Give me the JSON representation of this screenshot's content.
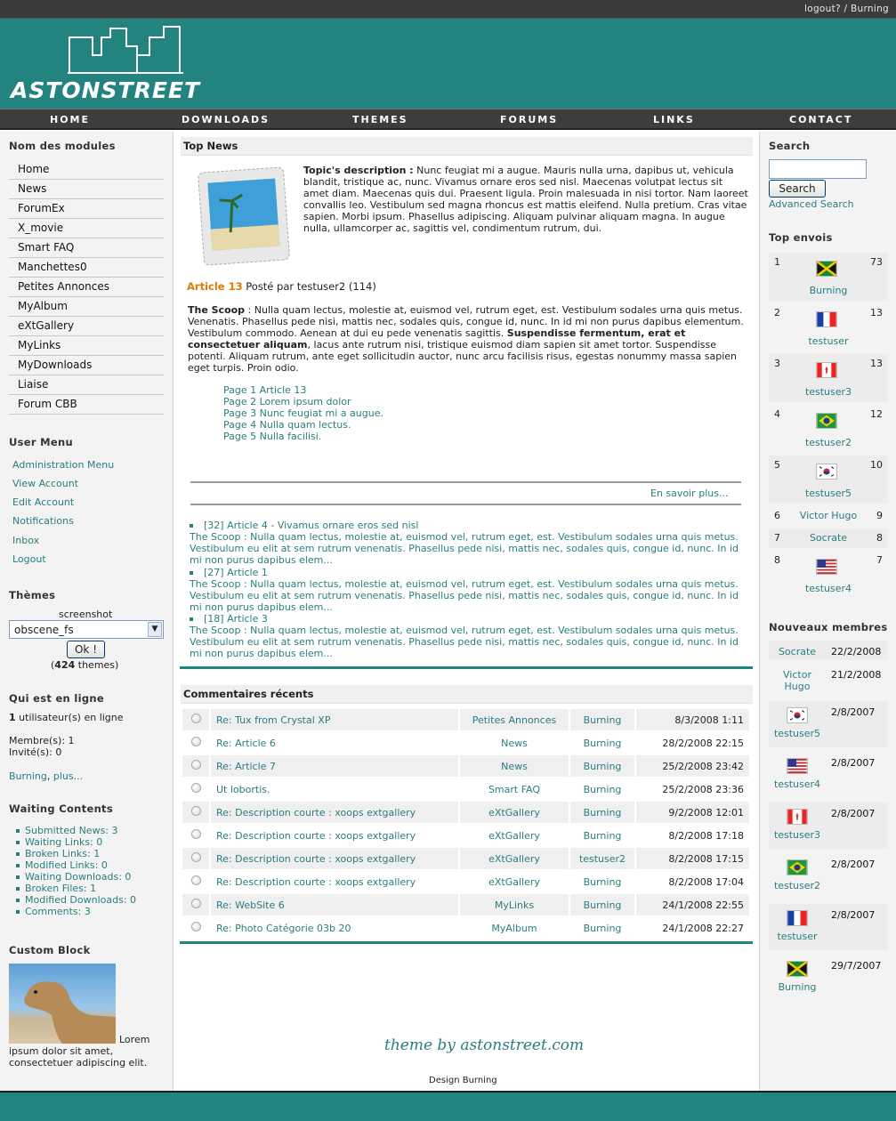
{
  "topbar": {
    "logout": "logout?",
    "sep": "/",
    "user": "Burning"
  },
  "logo": {
    "text": "ASTONSTREET"
  },
  "nav": [
    "HOME",
    "DOWNLOADS",
    "THEMES",
    "FORUMS",
    "LINKS",
    "CONTACT"
  ],
  "left": {
    "modules_title": "Nom des modules",
    "modules": [
      "Home",
      "News",
      "ForumEx",
      "X_movie",
      "Smart FAQ",
      "Manchettes0",
      "Petites Annonces",
      "MyAlbum",
      "eXtGallery",
      "MyLinks",
      "MyDownloads",
      "Liaise",
      "Forum CBB"
    ],
    "usermenu_title": "User Menu",
    "usermenu": [
      "Administration Menu",
      "View Account",
      "Edit Account",
      "Notifications",
      "Inbox",
      "Logout"
    ],
    "themes_title": "Thèmes",
    "themes_screenshot": "screenshot",
    "themes_selected": "obscene_fs",
    "themes_ok": "Ok !",
    "themes_count": "424",
    "themes_count_suffix": " themes)",
    "themes_count_prefix": "(",
    "online_title": "Qui est en ligne",
    "online_count": "1",
    "online_text": " utilisateur(s) en ligne",
    "members": "Membre(s): 1",
    "guests": "Invité(s): 0",
    "online_user": "Burning",
    "online_more": "plus...",
    "waiting_title": "Waiting Contents",
    "waiting": [
      "Submitted News: 3",
      "Waiting Links: 0",
      "Broken Links: 1",
      "Modified Links: 0",
      "Waiting Downloads: 0",
      "Broken Files: 1",
      "Modified Downloads: 0",
      "Comments: 3"
    ],
    "custom_title": "Custom Block",
    "custom_text": "Lorem ipsum dolor sit amet, consectetuer adipiscing elit."
  },
  "main": {
    "topnews_title": "Top News",
    "topic_label": "Topic's description :",
    "topic_text": " Nunc feugiat mi a augue. Mauris nulla urna, dapibus ut, vehicula blandit, tristique ac, nunc. Vivamus ornare eros sed nisl. Maecenas volutpat lectus sit amet diam. Maecenas quis dui. Praesent ligula. Proin malesuada in nisi tortor. Nam laoreet convallis leo. Vestibulum sed magna rhoncus est mattis eleifend. Nulla pretium. Cras vitae sapien. Morbi ipsum. Phasellus adipiscing. Aliquam pulvinar aliquam magna. In augue nulla, ullamcorper ac, sagittis vel, condimentum rutrum, dui.",
    "article_title": "Article 13",
    "article_by": " Posté par testuser2 (114)",
    "scoop_label": "The Scoop",
    "scoop_text1": " : Nulla quam lectus, molestie at, euismod vel, rutrum eget, est. Vestibulum sodales urna quis metus. Venenatis. Phasellus pede nisi, mattis nec, sodales quis, congue id, nunc. In id mi non purus dapibus elementum. Vestibulum commodo. Aenean at dui eu pede venenatis sagittis. ",
    "scoop_bold": "Suspendisse fermentum, erat et consectetuer aliquam",
    "scoop_text2": ", lacus ante rutrum nisi, tristique euismod diam sapien sit amet tortor. Suspendisse potenti. Aliquam rutrum, ante eget sollicitudin auctor, nunc arcu facilisis risus, egestas nonummy massa sapien eget turpis. Proin odio.",
    "pages": [
      "Page 1 Article 13",
      "Page 2 Lorem ipsum dolor",
      "Page 3 Nunc feugiat mi a augue.",
      "Page 4 Nulla quam lectus.",
      "Page 5 Nulla facilisi."
    ],
    "more": "En savoir plus...",
    "articles": [
      {
        "id": "[32]",
        "title": "Article 4 - Vivamus ornare eros sed nisl",
        "text": "The Scoop : Nulla quam lectus, molestie at, euismod vel, rutrum eget, est. Vestibulum sodales urna quis metus. Vestibulum eu elit at sem rutrum venenatis. Phasellus pede nisi, mattis nec, sodales quis, congue id, nunc. In id mi non purus dapibus elem..."
      },
      {
        "id": "[27]",
        "title": "Article 1",
        "text": "The Scoop : Nulla quam lectus, molestie at, euismod vel, rutrum eget, est. Vestibulum sodales urna quis metus. Vestibulum eu elit at sem rutrum venenatis. Phasellus pede nisi, mattis nec, sodales quis, congue id, nunc. In id mi non purus dapibus elem..."
      },
      {
        "id": "[18]",
        "title": "Article 3",
        "text": "The Scoop : Nulla quam lectus, molestie at, euismod vel, rutrum eget, est. Vestibulum sodales urna quis metus. Vestibulum eu elit at sem rutrum venenatis. Phasellus pede nisi, mattis nec, sodales quis, congue id, nunc. In id mi non purus dapibus elem..."
      }
    ],
    "comments_title": "Commentaires récents",
    "comments": [
      {
        "title": "Re: Tux from Crystal XP",
        "module": "Petites Annonces",
        "user": "Burning",
        "date": "8/3/2008 1:11",
        "icon": "circle-icon"
      },
      {
        "title": "Re: Article 6",
        "module": "News",
        "user": "Burning",
        "date": "28/2/2008 22:15",
        "icon": "circle-icon"
      },
      {
        "title": "Re: Article 7",
        "module": "News",
        "user": "Burning",
        "date": "25/2/2008 23:42",
        "icon": "circle-icon"
      },
      {
        "title": "Ut lobortis.",
        "module": "Smart FAQ",
        "user": "Burning",
        "date": "25/2/2008 23:36",
        "icon": "circle-icon"
      },
      {
        "title": "Re: Description courte : xoops extgallery",
        "module": "eXtGallery",
        "user": "Burning",
        "date": "9/2/2008 12:01",
        "icon": "smiley-icon"
      },
      {
        "title": "Re: Description courte : xoops extgallery",
        "module": "eXtGallery",
        "user": "Burning",
        "date": "8/2/2008 17:18",
        "icon": "circle-icon"
      },
      {
        "title": "Re: Description courte : xoops extgallery",
        "module": "eXtGallery",
        "user": "testuser2",
        "date": "8/2/2008 17:15",
        "icon": "circle-icon"
      },
      {
        "title": "Re: Description courte : xoops extgallery",
        "module": "eXtGallery",
        "user": "Burning",
        "date": "8/2/2008 17:04",
        "icon": "circle-icon"
      },
      {
        "title": "Re: WebSite 6",
        "module": "MyLinks",
        "user": "Burning",
        "date": "24/1/2008 22:55",
        "icon": "circle-icon"
      },
      {
        "title": "Re: Photo Catégorie 03b 20",
        "module": "MyAlbum",
        "user": "Burning",
        "date": "24/1/2008 22:27",
        "icon": "circle-icon"
      }
    ],
    "footer_sig": "theme by astonstreet.com",
    "footer_design": "Design Burning"
  },
  "right": {
    "search_title": "Search",
    "search_value": "",
    "search_button": "Search",
    "advanced": "Advanced Search",
    "top_title": "Top envois",
    "top": [
      {
        "rank": "1",
        "user": "Burning",
        "count": "73",
        "flag": "jamaica"
      },
      {
        "rank": "2",
        "user": "testuser",
        "count": "13",
        "flag": "france"
      },
      {
        "rank": "3",
        "user": "testuser3",
        "count": "13",
        "flag": "canada"
      },
      {
        "rank": "4",
        "user": "testuser2",
        "count": "12",
        "flag": "brazil"
      },
      {
        "rank": "5",
        "user": "testuser5",
        "count": "10",
        "flag": "korea"
      },
      {
        "rank": "6",
        "user": "Victor Hugo",
        "count": "9",
        "flag": ""
      },
      {
        "rank": "7",
        "user": "Socrate",
        "count": "8",
        "flag": ""
      },
      {
        "rank": "8",
        "user": "testuser4",
        "count": "7",
        "flag": "usa"
      }
    ],
    "new_title": "Nouveaux membres",
    "new": [
      {
        "user": "Socrate",
        "date": "22/2/2008",
        "flag": ""
      },
      {
        "user": "Victor Hugo",
        "date": "21/2/2008",
        "flag": ""
      },
      {
        "user": "testuser5",
        "date": "2/8/2007",
        "flag": "korea"
      },
      {
        "user": "testuser4",
        "date": "2/8/2007",
        "flag": "usa"
      },
      {
        "user": "testuser3",
        "date": "2/8/2007",
        "flag": "canada"
      },
      {
        "user": "testuser2",
        "date": "2/8/2007",
        "flag": "brazil"
      },
      {
        "user": "testuser",
        "date": "2/8/2007",
        "flag": "france"
      },
      {
        "user": "Burning",
        "date": "29/7/2007",
        "flag": "jamaica"
      }
    ]
  },
  "colors": {
    "brand": "#23837f",
    "link": "#2a7d7d",
    "accent": "#e07a00",
    "dark": "#3b3b3b"
  }
}
